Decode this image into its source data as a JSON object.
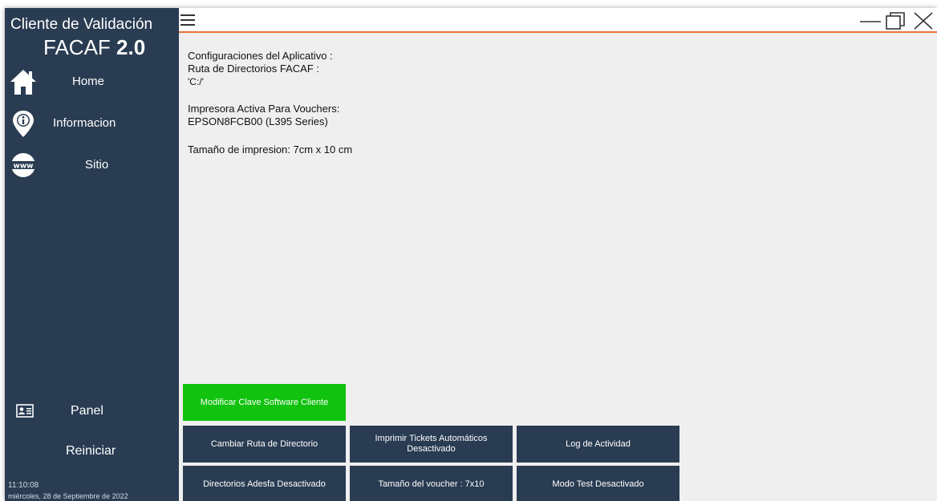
{
  "app": {
    "title_line1": "Cliente de Validación",
    "title_line2_prefix": "FACAF",
    "title_line2_version": "2.0"
  },
  "sidebar": {
    "nav": [
      {
        "label": "Home",
        "icon": "home-icon"
      },
      {
        "label": "Informacion",
        "icon": "info-pin-icon"
      },
      {
        "label": "Sitio",
        "icon": "www-globe-icon"
      }
    ],
    "panel_label": "Panel",
    "panel_icon": "id-card-icon",
    "restart_label": "Reiniciar",
    "clock": "11:10:08",
    "date": "miércoles, 28 de Septiembre de 2022"
  },
  "topbar": {
    "accent_color": "#e8733a"
  },
  "content": {
    "config_heading": "Configuraciones del Aplicativo :",
    "dir_label": "Ruta de Directorios FACAF :",
    "dir_value": "'C:/'",
    "printer_label": "Impresora Activa Para Vouchers:",
    "printer_value": "EPSON8FCB00 (L395 Series)",
    "print_size": "Tamaño de impresion: 7cm x 10 cm"
  },
  "buttons": {
    "modify_key": "Modificar Clave Software Cliente",
    "change_dir": "Cambiar Ruta de Directorio",
    "auto_print": "Imprimir Tickets Automáticos Desactivado",
    "activity_log": "Log de Actividad",
    "adesfa_dirs": "Directorios Adesfa Desactivado",
    "voucher_size": "Tamaño del voucher : 7x10",
    "test_mode": "Modo Test Desactivado"
  },
  "colors": {
    "sidebar": "#293c52",
    "green_button": "#11c20f",
    "background": "#efefef"
  }
}
